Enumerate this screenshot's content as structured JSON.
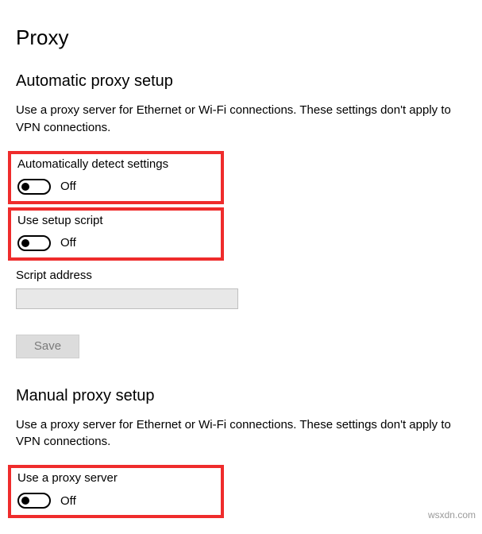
{
  "page": {
    "title": "Proxy"
  },
  "automatic": {
    "heading": "Automatic proxy setup",
    "description": "Use a proxy server for Ethernet or Wi-Fi connections. These settings don't apply to VPN connections.",
    "detect": {
      "label": "Automatically detect settings",
      "state": "Off"
    },
    "script": {
      "label": "Use setup script",
      "state": "Off"
    },
    "scriptAddress": {
      "label": "Script address",
      "value": ""
    },
    "saveLabel": "Save"
  },
  "manual": {
    "heading": "Manual proxy setup",
    "description": "Use a proxy server for Ethernet or Wi-Fi connections. These settings don't apply to VPN connections.",
    "useProxy": {
      "label": "Use a proxy server",
      "state": "Off"
    }
  },
  "watermark": "wsxdn.com"
}
